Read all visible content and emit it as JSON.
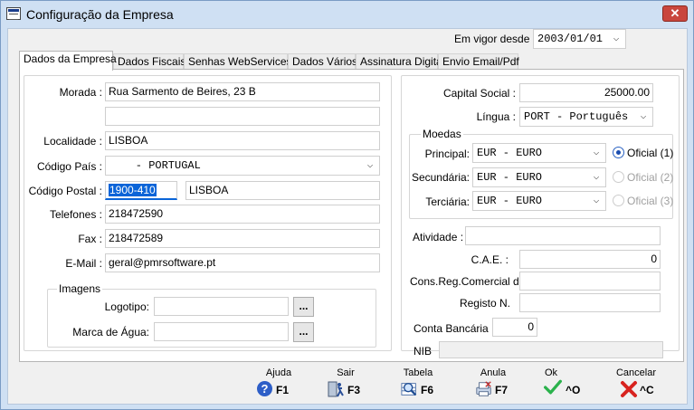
{
  "window": {
    "title": "Configuração da Empresa",
    "close_label": "✕"
  },
  "vigor": {
    "label": "Em vigor desde :",
    "value": "2003/01/01"
  },
  "tabs": [
    "Dados da Empresa",
    "Dados Fiscais",
    "Senhas WebServices",
    "Dados Vários",
    "Assinatura Digital",
    "Envio Email/Pdf"
  ],
  "left": {
    "morada_label": "Morada :",
    "morada_1": "Rua Sarmento de Beires, 23 B",
    "morada_2": "",
    "localidade_label": "Localidade :",
    "localidade": "LISBOA",
    "pais_label": "Código País :",
    "pais": "    - PORTUGAL",
    "cp_label": "Código Postal :",
    "cp": "1900-410",
    "cp_loc": "LISBOA",
    "tel_label": "Telefones :",
    "tel": "218472590",
    "fax_label": "Fax :",
    "fax": "218472589",
    "email_label": "E-Mail :",
    "email": "geral@pmrsoftware.pt",
    "imagens_title": "Imagens",
    "logotipo_label": "Logotipo:",
    "logotipo": "",
    "marca_label": "Marca de Água:",
    "marca": "",
    "browse_label": "..."
  },
  "right": {
    "capital_label": "Capital Social :",
    "capital": "25000.00",
    "lingua_label": "Língua :",
    "lingua": "PORT - Português",
    "moedas_title": "Moedas",
    "principal_label": "Principal:",
    "principal": "EUR - EURO",
    "secundaria_label": "Secundária:",
    "secundaria": "EUR - EURO",
    "terciaria_label": "Terciária:",
    "terciaria": "EUR - EURO",
    "oficial_1": "Oficial (1)",
    "oficial_2": "Oficial (2)",
    "oficial_3": "Oficial (3)",
    "atividade_label": "Atividade :",
    "atividade": "",
    "cae_label": "C.A.E. :",
    "cae": "0",
    "cons_label": "Cons.Reg.Comercial de",
    "cons": "",
    "registo_label": "Registo N.",
    "registo": "",
    "conta_label": "Conta Bancária",
    "conta": "0",
    "nib_label": "NIB",
    "nib": ""
  },
  "toolbar": {
    "ajuda": "Ajuda",
    "ajuda_key": "F1",
    "sair": "Sair",
    "sair_key": "F3",
    "tabela": "Tabela",
    "tabela_key": "F6",
    "anula": "Anula",
    "anula_key": "F7",
    "ok": "Ok",
    "ok_key": "^O",
    "cancelar": "Cancelar",
    "cancelar_key": "^C"
  },
  "icons": {
    "help": "help-icon",
    "exit": "exit-door-icon",
    "table": "magnifier-table-icon",
    "cancel_doc": "printer-cancel-icon",
    "ok": "checkmark-icon",
    "cancel": "cross-icon"
  },
  "colors": {
    "accent": "#2d5ec7",
    "ok_green": "#2bb24c",
    "cancel_red": "#d8231f",
    "selection": "#0a64d8"
  }
}
